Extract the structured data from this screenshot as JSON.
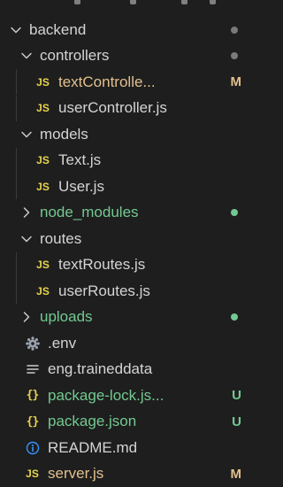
{
  "colors": {
    "background": "#1e1e1e",
    "folder_text": "#d4d4d4",
    "ignored_text": "#73c991",
    "modified_text": "#e2c08d",
    "untracked_text": "#73c991",
    "js_icon": "#e8d44d",
    "info_icon": "#3794ff",
    "dot_gray": "#7a7a7a",
    "dot_green": "#73c991"
  },
  "tree": {
    "items": [
      {
        "label": "backend",
        "kind": "folder",
        "expanded": true,
        "depth": 0,
        "icon": "chevron-down-icon",
        "status": "",
        "status_kind": "dot-gray",
        "text_color": "white"
      },
      {
        "label": "controllers",
        "kind": "folder",
        "expanded": true,
        "depth": 1,
        "icon": "chevron-down-icon",
        "status": "",
        "status_kind": "dot-gray",
        "text_color": "white"
      },
      {
        "label": "textControlle...",
        "kind": "js",
        "depth": 2,
        "icon": "js-icon",
        "status": "M",
        "status_kind": "letter",
        "text_color": "yellow"
      },
      {
        "label": "userController.js",
        "kind": "js",
        "depth": 2,
        "icon": "js-icon",
        "status": "",
        "status_kind": "none",
        "text_color": "white"
      },
      {
        "label": "models",
        "kind": "folder",
        "expanded": true,
        "depth": 1,
        "icon": "chevron-down-icon",
        "status": "",
        "status_kind": "none",
        "text_color": "white"
      },
      {
        "label": "Text.js",
        "kind": "js",
        "depth": 2,
        "icon": "js-icon",
        "status": "",
        "status_kind": "none",
        "text_color": "white"
      },
      {
        "label": "User.js",
        "kind": "js",
        "depth": 2,
        "icon": "js-icon",
        "status": "",
        "status_kind": "none",
        "text_color": "white"
      },
      {
        "label": "node_modules",
        "kind": "folder",
        "expanded": false,
        "depth": 1,
        "icon": "chevron-right-icon",
        "status": "",
        "status_kind": "dot-green",
        "text_color": "green"
      },
      {
        "label": "routes",
        "kind": "folder",
        "expanded": true,
        "depth": 1,
        "icon": "chevron-down-icon",
        "status": "",
        "status_kind": "none",
        "text_color": "white"
      },
      {
        "label": "textRoutes.js",
        "kind": "js",
        "depth": 2,
        "icon": "js-icon",
        "status": "",
        "status_kind": "none",
        "text_color": "white"
      },
      {
        "label": "userRoutes.js",
        "kind": "js",
        "depth": 2,
        "icon": "js-icon",
        "status": "",
        "status_kind": "none",
        "text_color": "white"
      },
      {
        "label": "uploads",
        "kind": "folder",
        "expanded": false,
        "depth": 1,
        "icon": "chevron-right-icon",
        "status": "",
        "status_kind": "dot-green",
        "text_color": "green"
      },
      {
        "label": ".env",
        "kind": "env",
        "depth": 1,
        "icon": "gear-icon",
        "status": "",
        "status_kind": "none",
        "text_color": "white"
      },
      {
        "label": "eng.traineddata",
        "kind": "data",
        "depth": 1,
        "icon": "lines-icon",
        "status": "",
        "status_kind": "none",
        "text_color": "white"
      },
      {
        "label": "package-lock.js...",
        "kind": "json",
        "depth": 1,
        "icon": "json-icon",
        "status": "U",
        "status_kind": "letter",
        "text_color": "green"
      },
      {
        "label": "package.json",
        "kind": "json",
        "depth": 1,
        "icon": "json-icon",
        "status": "U",
        "status_kind": "letter",
        "text_color": "green"
      },
      {
        "label": "README.md",
        "kind": "md",
        "depth": 1,
        "icon": "info-icon",
        "status": "",
        "status_kind": "none",
        "text_color": "white"
      },
      {
        "label": "server.js",
        "kind": "js",
        "depth": 1,
        "icon": "js-icon",
        "status": "M",
        "status_kind": "letter",
        "text_color": "yellow"
      }
    ],
    "icon_text": {
      "js": "JS",
      "json": "{}"
    }
  }
}
